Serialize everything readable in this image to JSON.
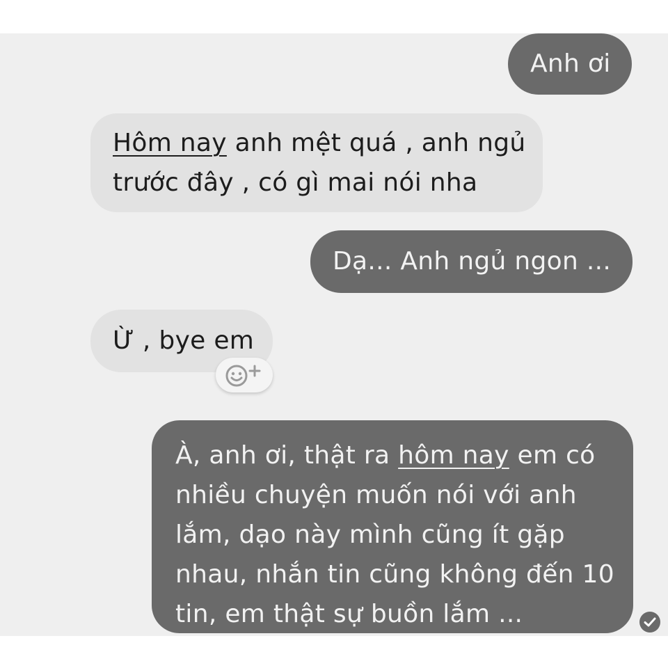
{
  "messages": [
    {
      "sender": "me",
      "text": "Anh ơi"
    },
    {
      "sender": "other",
      "underlined": "Hôm nay",
      "line1_rest": " anh mệt quá , anh ngủ",
      "line2": "trước đây , có gì mai nói nha"
    },
    {
      "sender": "me",
      "text": "Dạ... Anh ngủ ngon ..."
    },
    {
      "sender": "other",
      "text": "Ừ , bye em"
    },
    {
      "sender": "me",
      "line1_before": "À, anh ơi, thật ra ",
      "underlined": "hôm nay",
      "line1_after": " em có",
      "line2": "nhiều chuyện muốn nói với anh",
      "line3": "lắm, dạo này mình cũng ít gặp",
      "line4": "nhau, nhắn tin cũng không đến 10",
      "line5": "tin, em thật sự buồn lắm ..."
    }
  ],
  "icons": {
    "reaction": "smiley-plus-icon",
    "read_receipt": "check-circle-icon"
  },
  "colors": {
    "outgoing_bubble": "#6a6a6a",
    "incoming_bubble": "#e2e2e2",
    "chat_background": "#efefef"
  }
}
